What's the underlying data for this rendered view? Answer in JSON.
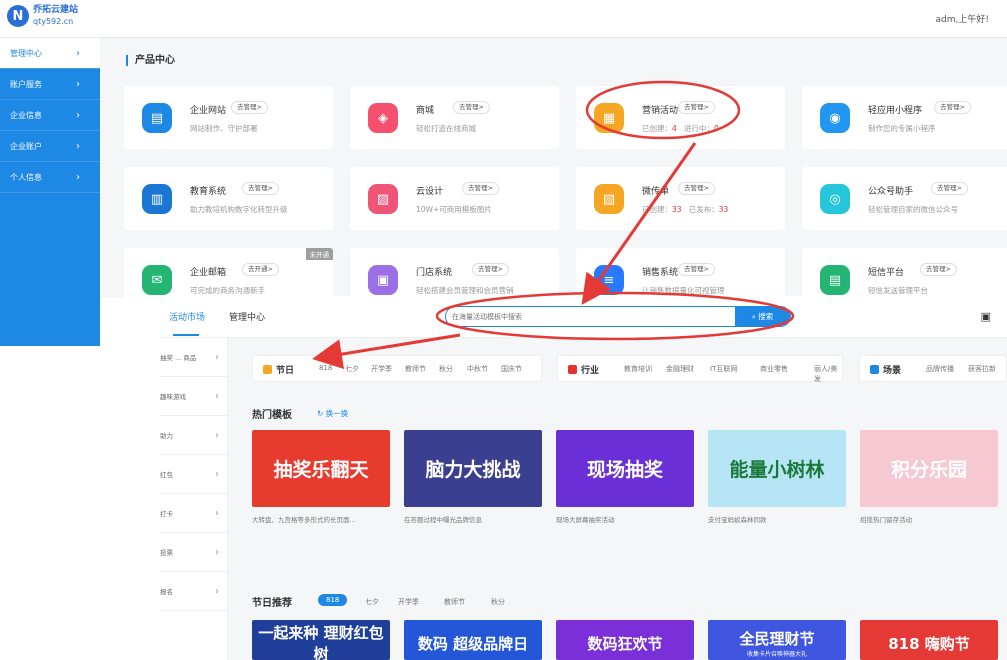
{
  "header": {
    "logo_letter": "N",
    "logo_name": "乔拓云建站",
    "logo_url": "qty592.cn",
    "greeting": "adm,上午好!"
  },
  "sidebar": {
    "items": [
      {
        "label": "管理中心"
      },
      {
        "label": "账户服务"
      },
      {
        "label": "企业信息"
      },
      {
        "label": "企业账户"
      },
      {
        "label": "个人信息"
      }
    ]
  },
  "product_center": {
    "title": "产品中心",
    "cards": [
      {
        "name": "企业网站",
        "button": "去管理>",
        "desc": "网站制作、守护部署",
        "icon": "website-icon",
        "color": "#1e88e5"
      },
      {
        "name": "商城",
        "button": "去管理>",
        "desc": "轻松打造在线商城",
        "icon": "bag-icon",
        "color": "#f5506e"
      },
      {
        "name": "营销活动",
        "button": "去管理>",
        "desc_prefix": "已创建：",
        "created": "4",
        "desc_mid": "进行中：",
        "running": "0",
        "icon": "gift-icon",
        "color": "#f5a623"
      },
      {
        "name": "轻应用小程序",
        "button": "去管理>",
        "desc": "制作您的专属小程序",
        "icon": "miniapp-icon",
        "color": "#2196f3"
      },
      {
        "name": "教育系统",
        "button": "去管理>",
        "desc": "助力教培机构数字化转型升级",
        "icon": "book-icon",
        "color": "#1976d2"
      },
      {
        "name": "云设计",
        "button": "去管理>",
        "desc": "10W+可商用模板图片",
        "icon": "image-icon",
        "color": "#ef5675"
      },
      {
        "name": "微传单",
        "button": "去管理>",
        "desc_prefix": "已创建：",
        "created": "33",
        "desc_mid": "已发布：",
        "published": "33",
        "icon": "flyer-icon",
        "color": "#f5a623"
      },
      {
        "name": "公众号助手",
        "button": "去管理>",
        "desc": "轻松管理自家的微信公众号",
        "icon": "wechat-icon",
        "color": "#26c6da"
      },
      {
        "name": "企业邮箱",
        "button": "去开通>",
        "desc": "可完成的商务沟通新手",
        "icon": "mail-icon",
        "color": "#22b573",
        "tag": "未开通"
      },
      {
        "name": "门店系统",
        "button": "去管理>",
        "desc": "轻松搭建会员管理和会员营销",
        "icon": "store-icon",
        "color": "#9c6fe4"
      },
      {
        "name": "销售系统",
        "button": "去管理>",
        "desc": "让销售数据量化可视管理",
        "icon": "list-icon",
        "color": "#2979ff"
      },
      {
        "name": "短信平台",
        "button": "去管理>",
        "desc": "短信发送管理平台",
        "icon": "sms-icon",
        "color": "#22b573"
      }
    ]
  },
  "market": {
    "tabs": [
      {
        "label": "活动市场"
      },
      {
        "label": "管理中心"
      }
    ],
    "search_placeholder": "在海量活动模板中搜索",
    "search_button": "搜索",
    "side_items": [
      "抽奖 ... 商品",
      "趣味游戏",
      "助力",
      "红包",
      "打卡",
      "投票",
      "报名"
    ],
    "filters": [
      {
        "title": "节日",
        "options": [
          "818",
          "七夕",
          "开学季",
          "教师节",
          "秋分",
          "中秋节",
          "国庆节"
        ],
        "color": "#f5a623"
      },
      {
        "title": "行业",
        "options": [
          "教育培训",
          "金融理财",
          "IT互联网",
          "商业零售",
          "丽人/美发"
        ],
        "color": "#e5322d"
      },
      {
        "title": "场景",
        "options": [
          "品牌传播",
          "获客拉新"
        ],
        "color": "#1e88e5"
      }
    ],
    "hot_title": "热门模板",
    "refresh_label": "换一换",
    "hot_templates": [
      {
        "text": "抽奖乐翻天",
        "desc": "大转盘、九宫格等多形式的长页面...",
        "bg": "#e83b2f"
      },
      {
        "text": "脑力大挑战",
        "desc": "在答题过程中曝光品牌信息",
        "bg": "#3a3f8f"
      },
      {
        "text": "现场抽奖",
        "desc": "现场大屏幕抽奖活动",
        "bg": "#6a2fd6"
      },
      {
        "text": "能量小树林",
        "desc": "支付宝蚂蚁森林同款",
        "bg": "#b6e5f5"
      },
      {
        "text": "积分乐园",
        "desc": "招揽热门留存活动",
        "bg": "#f6c9d2"
      }
    ],
    "holiday_title": "节日推荐",
    "holiday_pills": [
      "818",
      "七夕",
      "开学季",
      "教师节",
      "秋分"
    ],
    "holiday_templates": [
      {
        "text": "一起来种 理财红包树",
        "bg": "#1f3f9b"
      },
      {
        "text": "数码 超级品牌日",
        "bg": "#2456d8"
      },
      {
        "text": "数码狂欢节",
        "bg": "#7b2fd8"
      },
      {
        "text": "全民理财节",
        "sub": "收集卡片召唤神器大礼",
        "bg": "#3f56e0"
      },
      {
        "text": "818 嗨购节",
        "bg": "#e53935"
      }
    ]
  }
}
